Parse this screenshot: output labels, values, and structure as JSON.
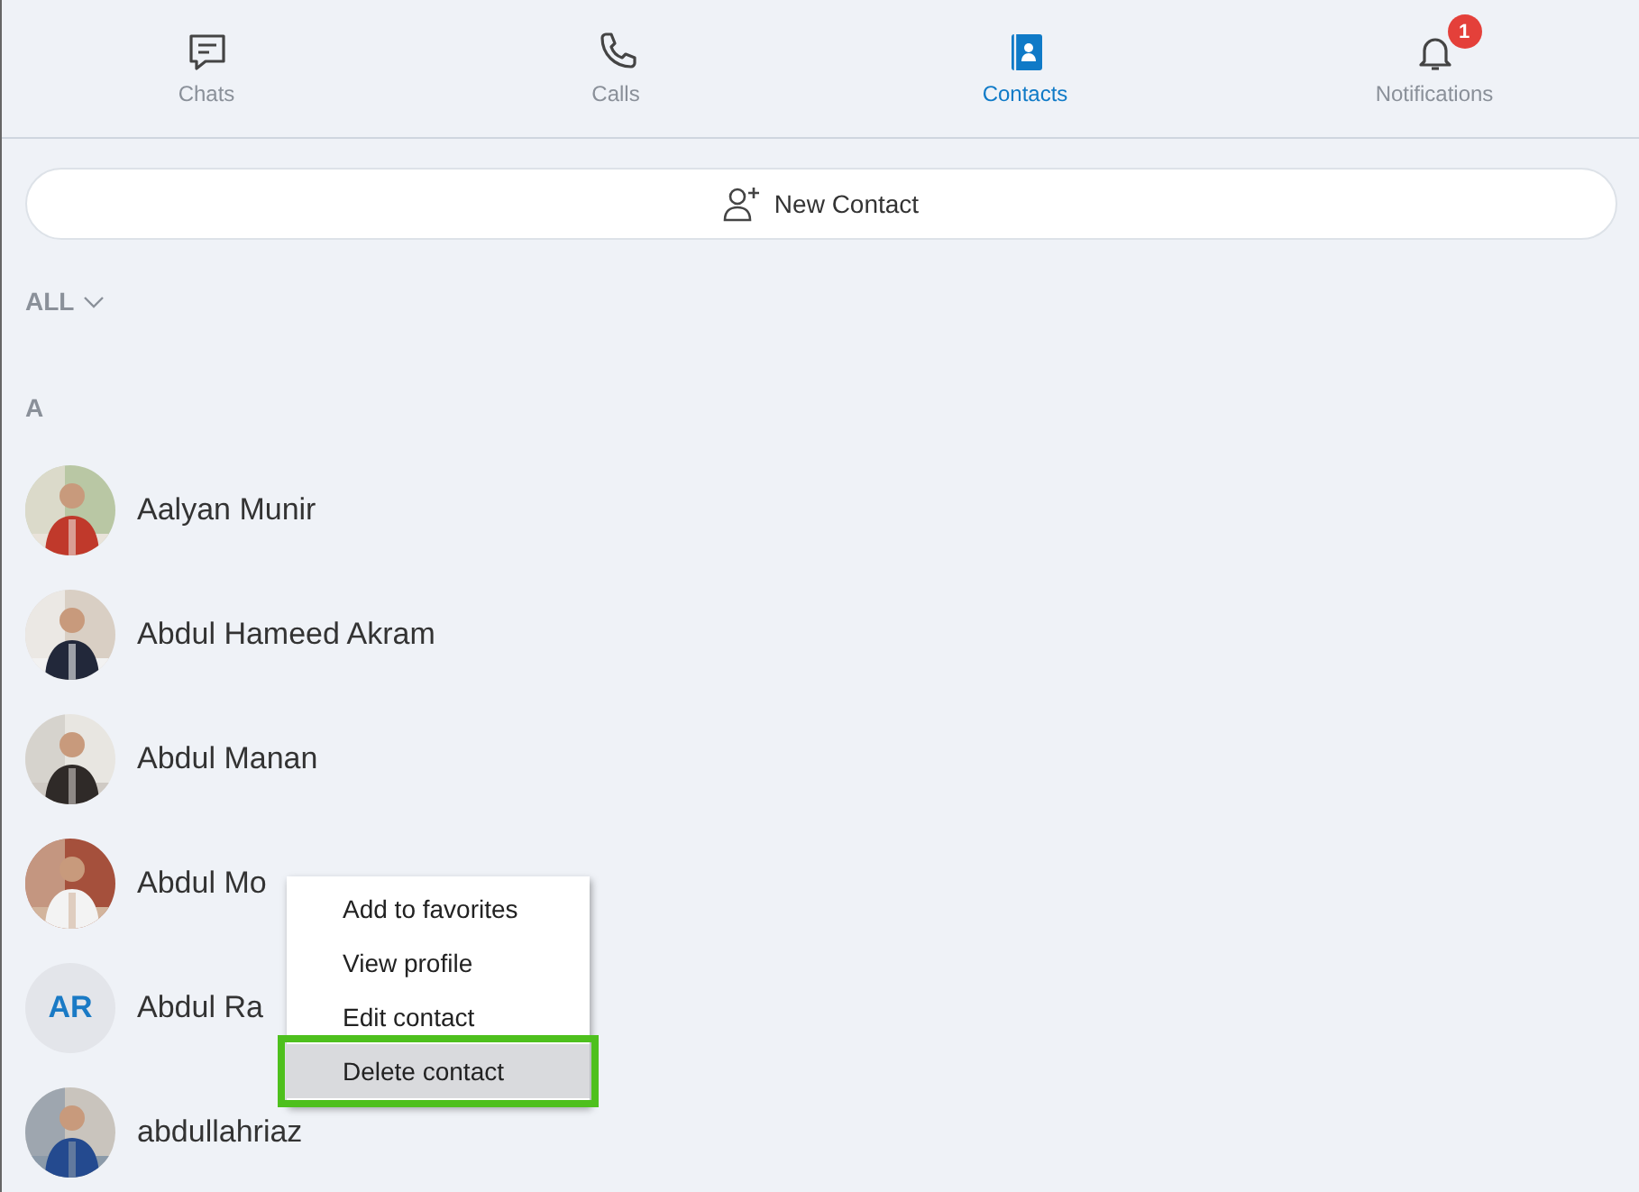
{
  "tabs": [
    {
      "label": "Chats",
      "selected": false
    },
    {
      "label": "Calls",
      "selected": false
    },
    {
      "label": "Contacts",
      "selected": true
    },
    {
      "label": "Notifications",
      "selected": false,
      "badge": "1"
    }
  ],
  "new_contact_button": {
    "label": "New Contact"
  },
  "filter": {
    "label": "ALL"
  },
  "section": {
    "letter": "A"
  },
  "contacts": [
    {
      "name": "Aalyan Munir"
    },
    {
      "name": "Abdul Hameed Akram"
    },
    {
      "name": "Abdul Manan"
    },
    {
      "name": "Abdul Mo"
    },
    {
      "name": "Abdul Ra",
      "kind": "initials",
      "initials": "AR"
    },
    {
      "name": "abdullahriaz"
    }
  ],
  "context_menu": {
    "items": [
      {
        "label": "Add to favorites",
        "selected": false
      },
      {
        "label": "View profile",
        "selected": false
      },
      {
        "label": "Edit contact",
        "selected": false
      },
      {
        "label": "Delete contact",
        "selected": true
      }
    ]
  }
}
